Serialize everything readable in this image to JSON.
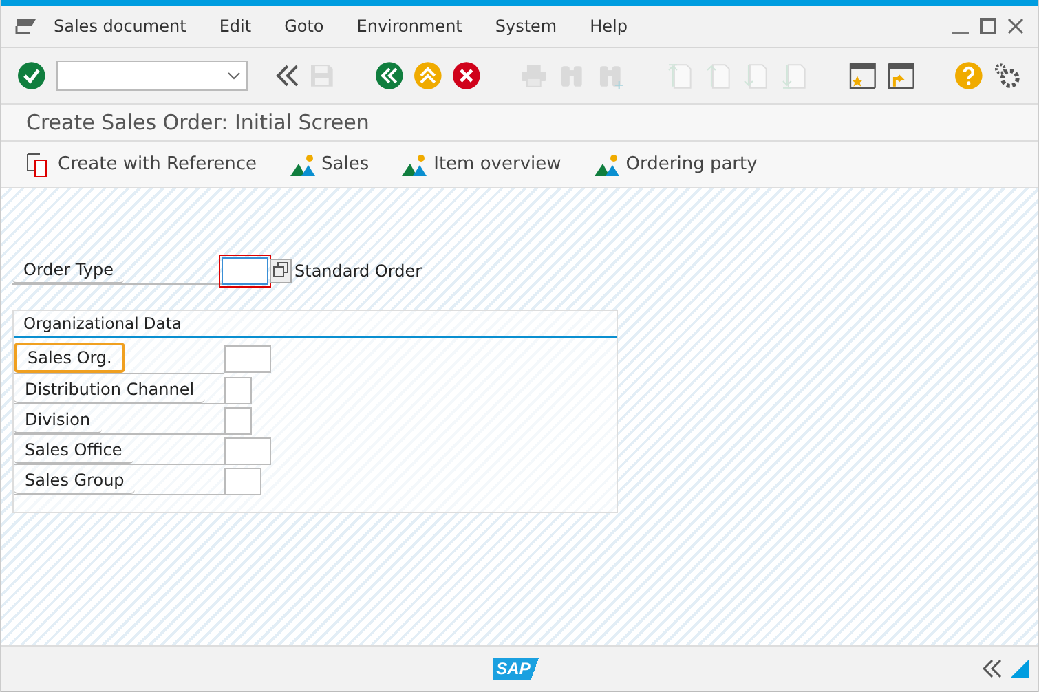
{
  "menu": [
    {
      "label": "Sales document"
    },
    {
      "label": "Edit"
    },
    {
      "label": "Goto"
    },
    {
      "label": "Environment"
    },
    {
      "label": "System"
    },
    {
      "label": "Help"
    }
  ],
  "toolbar": [
    {
      "kind": "enter",
      "disabled": false
    },
    {
      "kind": "command",
      "disabled": false
    },
    {
      "kind": "collapse",
      "disabled": false
    },
    {
      "kind": "save",
      "disabled": true
    },
    {
      "kind": "back",
      "disabled": false
    },
    {
      "kind": "exit",
      "disabled": false
    },
    {
      "kind": "cancel",
      "disabled": false
    },
    {
      "kind": "print",
      "disabled": true
    },
    {
      "kind": "find",
      "disabled": true
    },
    {
      "kind": "findnext",
      "disabled": true
    },
    {
      "kind": "first",
      "disabled": true
    },
    {
      "kind": "prev",
      "disabled": true
    },
    {
      "kind": "next",
      "disabled": true
    },
    {
      "kind": "last",
      "disabled": true
    },
    {
      "kind": "session",
      "disabled": false
    },
    {
      "kind": "shortcut",
      "disabled": false
    },
    {
      "kind": "help",
      "disabled": false
    },
    {
      "kind": "settings",
      "disabled": false
    }
  ],
  "title": "Create Sales Order: Initial Screen",
  "app_toolbar": [
    {
      "label": "Create with Reference",
      "kind": "reference"
    },
    {
      "label": "Sales",
      "kind": "overview"
    },
    {
      "label": "Item overview",
      "kind": "overview"
    },
    {
      "label": "Ordering party",
      "kind": "overview"
    }
  ],
  "order_type": {
    "label": "Order Type",
    "focused": true,
    "description": "Standard Order"
  },
  "org_data": {
    "title": "Organizational Data",
    "fields": [
      {
        "label": "Sales Org.",
        "highlighted": true
      },
      {
        "label": "Distribution Channel",
        "highlighted": false
      },
      {
        "label": "Division",
        "highlighted": false
      },
      {
        "label": "Sales Office",
        "highlighted": false
      },
      {
        "label": "Sales Group",
        "highlighted": false
      }
    ]
  },
  "status_bar": {
    "logo": "SAP"
  }
}
